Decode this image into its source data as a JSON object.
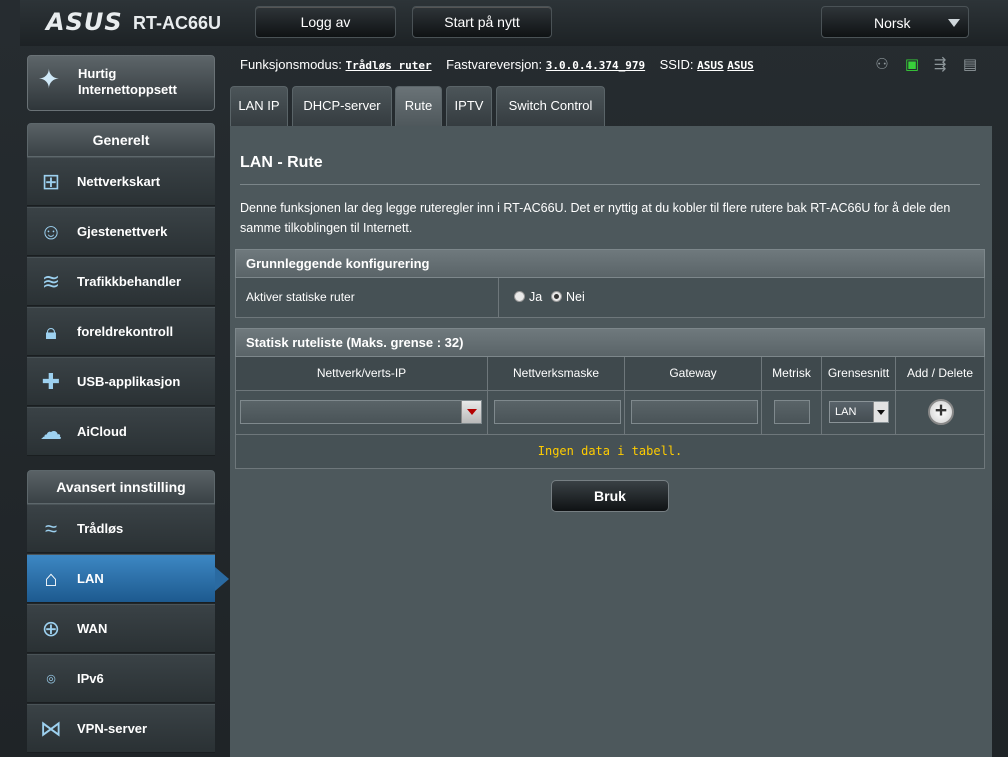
{
  "brand": {
    "logo": "ASUS",
    "model": "RT-AC66U"
  },
  "top": {
    "logout": "Logg av",
    "reboot": "Start på nytt",
    "language": "Norsk"
  },
  "quick_setup": {
    "line1": "Hurtig",
    "line2": "Internettoppsett"
  },
  "general": {
    "header": "Generelt",
    "items": [
      {
        "label": "Nettverkskart"
      },
      {
        "label": "Gjestenettverk"
      },
      {
        "label": "Trafikkbehandler"
      },
      {
        "label": "foreldrekontroll"
      },
      {
        "label": "USB-applikasjon"
      },
      {
        "label": "AiCloud"
      }
    ]
  },
  "advanced": {
    "header": "Avansert innstilling",
    "items": [
      {
        "label": "Trådløs"
      },
      {
        "label": "LAN"
      },
      {
        "label": "WAN"
      },
      {
        "label": "IPv6"
      },
      {
        "label": "VPN-server"
      }
    ]
  },
  "info": {
    "mode_label": "Funksjonsmodus:",
    "mode_value": "Trådløs ruter",
    "fw_label": "Fastvareversjon:",
    "fw_value": "3.0.0.4.374_979",
    "ssid_label": "SSID:",
    "ssid_1": "ASUS",
    "ssid_2": "ASUS"
  },
  "tabs": [
    {
      "label": "LAN IP"
    },
    {
      "label": "DHCP-server"
    },
    {
      "label": "Rute"
    },
    {
      "label": "IPTV"
    },
    {
      "label": "Switch Control"
    }
  ],
  "page": {
    "title": "LAN - Rute",
    "description": "Denne funksjonen lar deg legge ruteregler inn i RT-AC66U. Det er nyttig at du kobler til flere rutere bak RT-AC66U for å dele den samme tilkoblingen til Internett."
  },
  "basic_config": {
    "header": "Grunnleggende konfigurering",
    "static_routes_label": "Aktiver statiske ruter",
    "yes": "Ja",
    "no": "Nei",
    "selected": "Nei"
  },
  "route_list": {
    "header": "Statisk ruteliste (Maks. grense : 32)",
    "columns": [
      "Nettverk/verts-IP",
      "Nettverksmaske",
      "Gateway",
      "Metrisk",
      "Grensesnitt",
      "Add / Delete"
    ],
    "interface_value": "LAN",
    "no_data": "Ingen data i tabell."
  },
  "apply_label": "Bruk",
  "colors": {
    "accent_active": "#2a6aa1",
    "no_data_text": "#ffcc00"
  }
}
